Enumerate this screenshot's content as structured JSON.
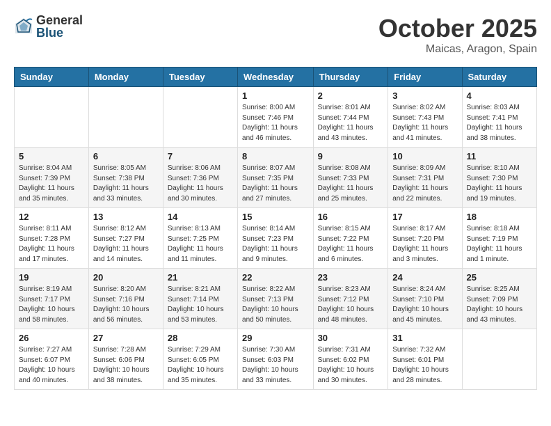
{
  "header": {
    "logo_general": "General",
    "logo_blue": "Blue",
    "month": "October 2025",
    "location": "Maicas, Aragon, Spain"
  },
  "weekdays": [
    "Sunday",
    "Monday",
    "Tuesday",
    "Wednesday",
    "Thursday",
    "Friday",
    "Saturday"
  ],
  "weeks": [
    [
      {
        "day": "",
        "info": ""
      },
      {
        "day": "",
        "info": ""
      },
      {
        "day": "",
        "info": ""
      },
      {
        "day": "1",
        "info": "Sunrise: 8:00 AM\nSunset: 7:46 PM\nDaylight: 11 hours\nand 46 minutes."
      },
      {
        "day": "2",
        "info": "Sunrise: 8:01 AM\nSunset: 7:44 PM\nDaylight: 11 hours\nand 43 minutes."
      },
      {
        "day": "3",
        "info": "Sunrise: 8:02 AM\nSunset: 7:43 PM\nDaylight: 11 hours\nand 41 minutes."
      },
      {
        "day": "4",
        "info": "Sunrise: 8:03 AM\nSunset: 7:41 PM\nDaylight: 11 hours\nand 38 minutes."
      }
    ],
    [
      {
        "day": "5",
        "info": "Sunrise: 8:04 AM\nSunset: 7:39 PM\nDaylight: 11 hours\nand 35 minutes."
      },
      {
        "day": "6",
        "info": "Sunrise: 8:05 AM\nSunset: 7:38 PM\nDaylight: 11 hours\nand 33 minutes."
      },
      {
        "day": "7",
        "info": "Sunrise: 8:06 AM\nSunset: 7:36 PM\nDaylight: 11 hours\nand 30 minutes."
      },
      {
        "day": "8",
        "info": "Sunrise: 8:07 AM\nSunset: 7:35 PM\nDaylight: 11 hours\nand 27 minutes."
      },
      {
        "day": "9",
        "info": "Sunrise: 8:08 AM\nSunset: 7:33 PM\nDaylight: 11 hours\nand 25 minutes."
      },
      {
        "day": "10",
        "info": "Sunrise: 8:09 AM\nSunset: 7:31 PM\nDaylight: 11 hours\nand 22 minutes."
      },
      {
        "day": "11",
        "info": "Sunrise: 8:10 AM\nSunset: 7:30 PM\nDaylight: 11 hours\nand 19 minutes."
      }
    ],
    [
      {
        "day": "12",
        "info": "Sunrise: 8:11 AM\nSunset: 7:28 PM\nDaylight: 11 hours\nand 17 minutes."
      },
      {
        "day": "13",
        "info": "Sunrise: 8:12 AM\nSunset: 7:27 PM\nDaylight: 11 hours\nand 14 minutes."
      },
      {
        "day": "14",
        "info": "Sunrise: 8:13 AM\nSunset: 7:25 PM\nDaylight: 11 hours\nand 11 minutes."
      },
      {
        "day": "15",
        "info": "Sunrise: 8:14 AM\nSunset: 7:23 PM\nDaylight: 11 hours\nand 9 minutes."
      },
      {
        "day": "16",
        "info": "Sunrise: 8:15 AM\nSunset: 7:22 PM\nDaylight: 11 hours\nand 6 minutes."
      },
      {
        "day": "17",
        "info": "Sunrise: 8:17 AM\nSunset: 7:20 PM\nDaylight: 11 hours\nand 3 minutes."
      },
      {
        "day": "18",
        "info": "Sunrise: 8:18 AM\nSunset: 7:19 PM\nDaylight: 11 hours\nand 1 minute."
      }
    ],
    [
      {
        "day": "19",
        "info": "Sunrise: 8:19 AM\nSunset: 7:17 PM\nDaylight: 10 hours\nand 58 minutes."
      },
      {
        "day": "20",
        "info": "Sunrise: 8:20 AM\nSunset: 7:16 PM\nDaylight: 10 hours\nand 56 minutes."
      },
      {
        "day": "21",
        "info": "Sunrise: 8:21 AM\nSunset: 7:14 PM\nDaylight: 10 hours\nand 53 minutes."
      },
      {
        "day": "22",
        "info": "Sunrise: 8:22 AM\nSunset: 7:13 PM\nDaylight: 10 hours\nand 50 minutes."
      },
      {
        "day": "23",
        "info": "Sunrise: 8:23 AM\nSunset: 7:12 PM\nDaylight: 10 hours\nand 48 minutes."
      },
      {
        "day": "24",
        "info": "Sunrise: 8:24 AM\nSunset: 7:10 PM\nDaylight: 10 hours\nand 45 minutes."
      },
      {
        "day": "25",
        "info": "Sunrise: 8:25 AM\nSunset: 7:09 PM\nDaylight: 10 hours\nand 43 minutes."
      }
    ],
    [
      {
        "day": "26",
        "info": "Sunrise: 7:27 AM\nSunset: 6:07 PM\nDaylight: 10 hours\nand 40 minutes."
      },
      {
        "day": "27",
        "info": "Sunrise: 7:28 AM\nSunset: 6:06 PM\nDaylight: 10 hours\nand 38 minutes."
      },
      {
        "day": "28",
        "info": "Sunrise: 7:29 AM\nSunset: 6:05 PM\nDaylight: 10 hours\nand 35 minutes."
      },
      {
        "day": "29",
        "info": "Sunrise: 7:30 AM\nSunset: 6:03 PM\nDaylight: 10 hours\nand 33 minutes."
      },
      {
        "day": "30",
        "info": "Sunrise: 7:31 AM\nSunset: 6:02 PM\nDaylight: 10 hours\nand 30 minutes."
      },
      {
        "day": "31",
        "info": "Sunrise: 7:32 AM\nSunset: 6:01 PM\nDaylight: 10 hours\nand 28 minutes."
      },
      {
        "day": "",
        "info": ""
      }
    ]
  ]
}
